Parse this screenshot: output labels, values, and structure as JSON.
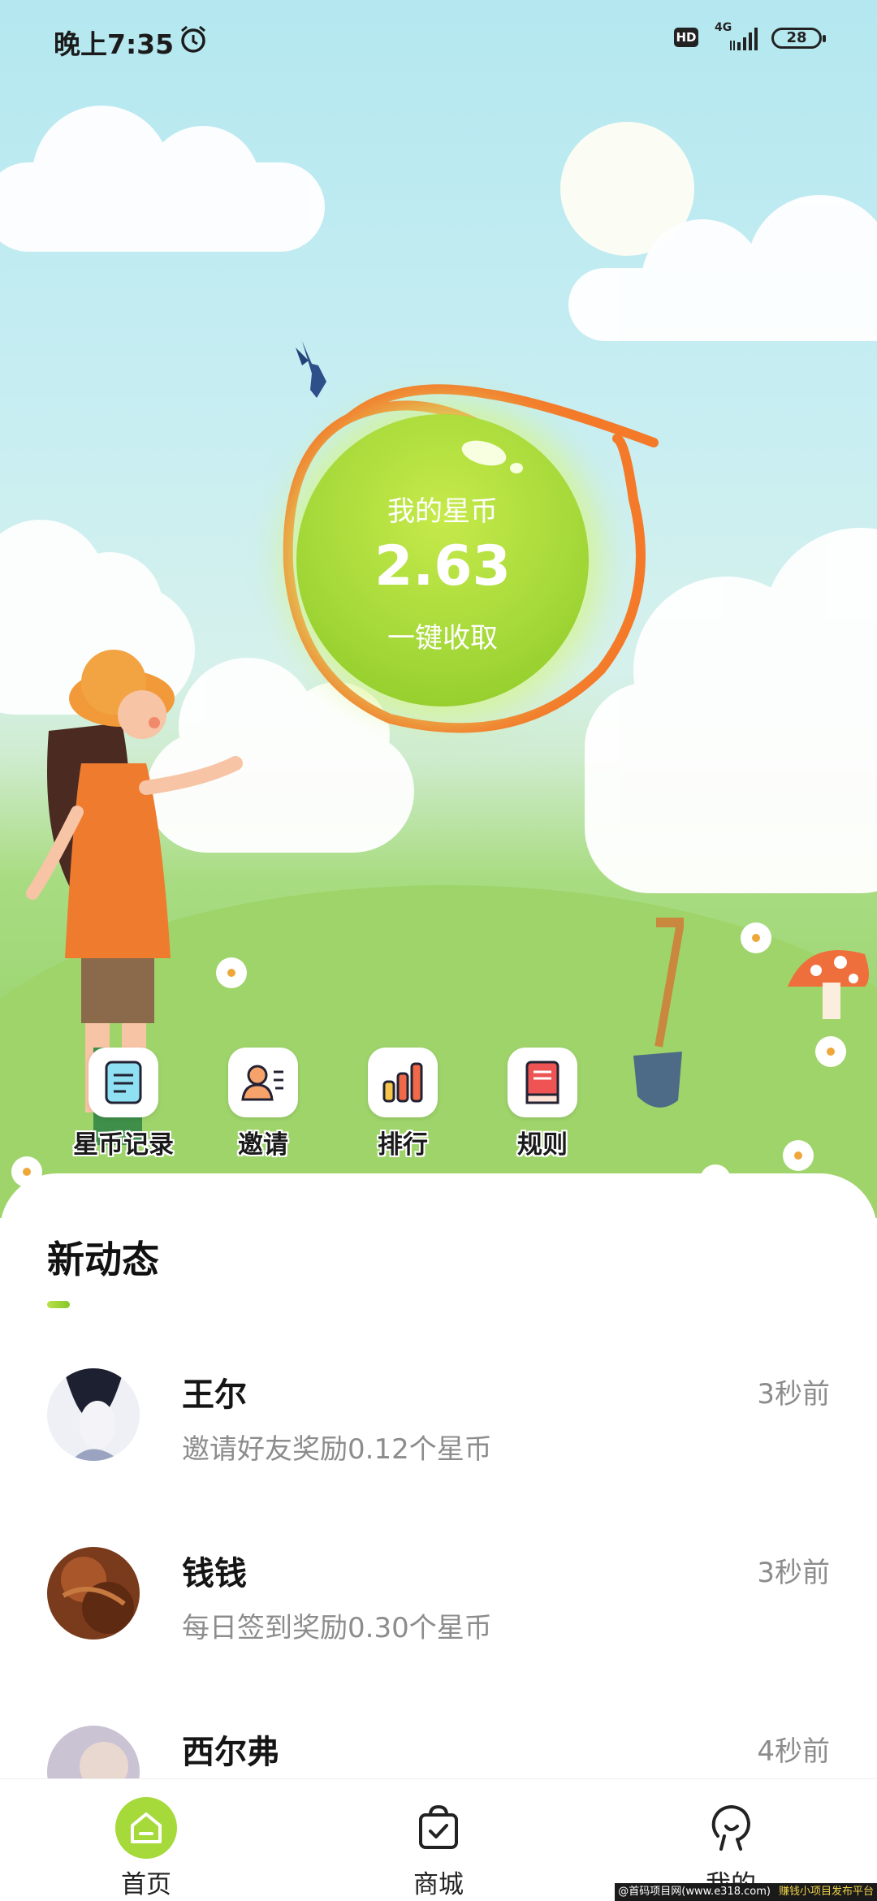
{
  "status_bar": {
    "time": "晚上7:35",
    "hd": "HD",
    "network": "4G",
    "battery": "28"
  },
  "coin": {
    "label": "我的星币",
    "value": "2.63",
    "collect": "一键收取",
    "ring_color": "#f47a2a"
  },
  "actions": [
    {
      "label": "星币记录",
      "icon": "record-icon"
    },
    {
      "label": "邀请",
      "icon": "invite-icon"
    },
    {
      "label": "排行",
      "icon": "ranking-icon"
    },
    {
      "label": "规则",
      "icon": "rules-book-icon"
    }
  ],
  "feed": {
    "title": "新动态",
    "items": [
      {
        "name": "王尔",
        "desc": "邀请好友奖励0.12个星币",
        "ago": "3秒前"
      },
      {
        "name": "钱钱",
        "desc": "每日签到奖励0.30个星币",
        "ago": "3秒前"
      },
      {
        "name": "西尔弗",
        "desc": "",
        "ago": "4秒前"
      }
    ]
  },
  "nav": {
    "items": [
      {
        "label": "首页",
        "icon": "home-icon",
        "active": true
      },
      {
        "label": "商城",
        "icon": "shopping-bag-icon",
        "active": false
      },
      {
        "label": "我的",
        "icon": "profile-icon",
        "active": false
      }
    ],
    "accent": "#a6d93a"
  },
  "watermark": {
    "left": "@首码项目网(www.e318.com)",
    "right": "赚钱小项目发布平台"
  }
}
